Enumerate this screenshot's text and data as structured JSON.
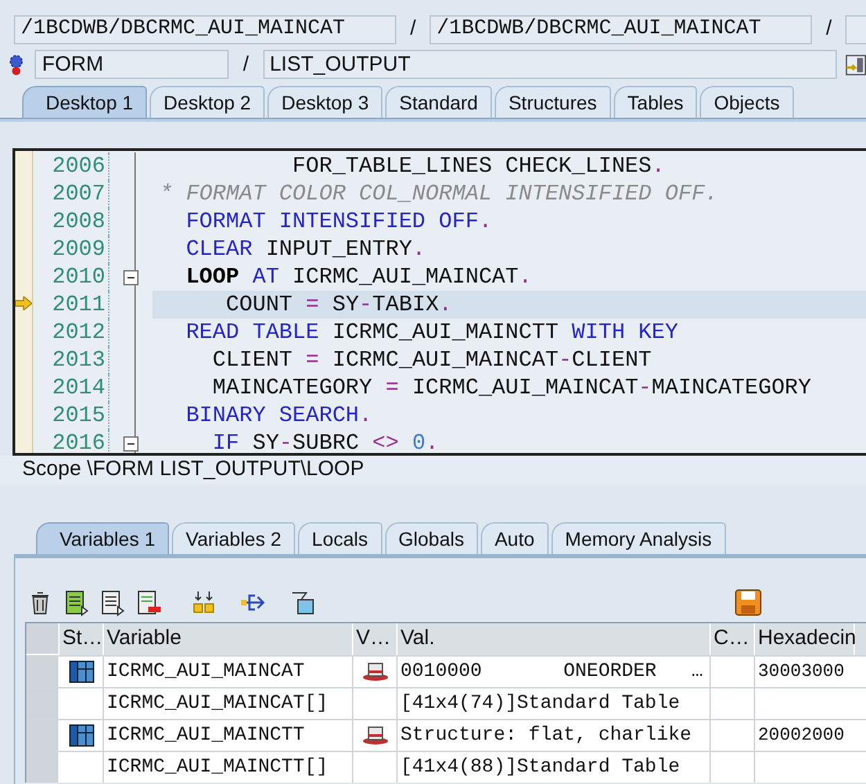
{
  "header": {
    "program_fields": [
      "/1BCDWB/DBCRMC_AUI_MAINCAT",
      "/1BCDWB/DBCRMC_AUI_MAINCAT"
    ],
    "separator": "/",
    "event_type": "FORM",
    "event_name": "LIST_OUTPUT"
  },
  "desktop_tabs": [
    {
      "label": "Desktop 1",
      "selected": true
    },
    {
      "label": "Desktop 2",
      "selected": false
    },
    {
      "label": "Desktop 3",
      "selected": false
    },
    {
      "label": "Standard",
      "selected": false
    },
    {
      "label": "Structures",
      "selected": false
    },
    {
      "label": "Tables",
      "selected": false
    },
    {
      "label": "Objects",
      "selected": false
    }
  ],
  "code": {
    "lines": [
      {
        "number": "2006",
        "current": false,
        "foldable": false,
        "tokens": [
          {
            "kind": "plain",
            "text": "          FOR_TABLE_LINES CHECK_LINES"
          },
          {
            "kind": "operator",
            "text": "."
          }
        ]
      },
      {
        "number": "2007",
        "current": false,
        "foldable": false,
        "tokens": [
          {
            "kind": "comment",
            "text": "* FORMAT COLOR COL_NORMAL INTENSIFIED OFF."
          }
        ]
      },
      {
        "number": "2008",
        "current": false,
        "foldable": false,
        "tokens": [
          {
            "kind": "keyword",
            "text": "  FORMAT INTENSIFIED OFF"
          },
          {
            "kind": "operator",
            "text": "."
          }
        ]
      },
      {
        "number": "2009",
        "current": false,
        "foldable": false,
        "tokens": [
          {
            "kind": "keyword",
            "text": "  CLEAR"
          },
          {
            "kind": "plain",
            "text": " INPUT_ENTRY"
          },
          {
            "kind": "operator",
            "text": "."
          }
        ]
      },
      {
        "number": "2010",
        "current": false,
        "foldable": true,
        "tokens": [
          {
            "kind": "strong",
            "text": "  LOOP"
          },
          {
            "kind": "keyword",
            "text": " AT"
          },
          {
            "kind": "plain",
            "text": " ICRMC_AUI_MAINCAT"
          },
          {
            "kind": "operator",
            "text": "."
          }
        ]
      },
      {
        "number": "2011",
        "current": true,
        "foldable": false,
        "tokens": [
          {
            "kind": "plain",
            "text": "     COUNT "
          },
          {
            "kind": "operator",
            "text": "="
          },
          {
            "kind": "plain",
            "text": " SY"
          },
          {
            "kind": "operator",
            "text": "-"
          },
          {
            "kind": "plain",
            "text": "TABIX"
          },
          {
            "kind": "operator",
            "text": "."
          }
        ]
      },
      {
        "number": "2012",
        "current": false,
        "foldable": false,
        "tokens": [
          {
            "kind": "keyword",
            "text": "  READ TABLE"
          },
          {
            "kind": "plain",
            "text": " ICRMC_AUI_MAINCTT "
          },
          {
            "kind": "keyword",
            "text": "WITH KEY"
          }
        ]
      },
      {
        "number": "2013",
        "current": false,
        "foldable": false,
        "tokens": [
          {
            "kind": "plain",
            "text": "    CLIENT "
          },
          {
            "kind": "operator",
            "text": "="
          },
          {
            "kind": "plain",
            "text": " ICRMC_AUI_MAINCAT"
          },
          {
            "kind": "operator",
            "text": "-"
          },
          {
            "kind": "plain",
            "text": "CLIENT"
          }
        ]
      },
      {
        "number": "2014",
        "current": false,
        "foldable": false,
        "tokens": [
          {
            "kind": "plain",
            "text": "    MAINCATEGORY "
          },
          {
            "kind": "operator",
            "text": "="
          },
          {
            "kind": "plain",
            "text": " ICRMC_AUI_MAINCAT"
          },
          {
            "kind": "operator",
            "text": "-"
          },
          {
            "kind": "plain",
            "text": "MAINCATEGORY"
          }
        ]
      },
      {
        "number": "2015",
        "current": false,
        "foldable": false,
        "tokens": [
          {
            "kind": "keyword",
            "text": "  BINARY SEARCH"
          },
          {
            "kind": "operator",
            "text": "."
          }
        ]
      },
      {
        "number": "2016",
        "current": false,
        "foldable": true,
        "tokens": [
          {
            "kind": "keyword",
            "text": "    IF"
          },
          {
            "kind": "plain",
            "text": " SY"
          },
          {
            "kind": "operator",
            "text": "-"
          },
          {
            "kind": "plain",
            "text": "SUBRC "
          },
          {
            "kind": "operator",
            "text": "<>"
          },
          {
            "kind": "number",
            "text": " 0"
          },
          {
            "kind": "operator",
            "text": "."
          }
        ]
      }
    ]
  },
  "scope": "Scope \\FORM LIST_OUTPUT\\LOOP",
  "variable_tabs": [
    {
      "label": "Variables 1",
      "selected": true
    },
    {
      "label": "Variables 2",
      "selected": false
    },
    {
      "label": "Locals",
      "selected": false
    },
    {
      "label": "Globals",
      "selected": false
    },
    {
      "label": "Auto",
      "selected": false
    },
    {
      "label": "Memory Analysis",
      "selected": false
    }
  ],
  "table": {
    "columns": [
      "St…",
      "Variable",
      "V…",
      "Val.",
      "C…",
      "Hexadecin"
    ],
    "rows": [
      {
        "kind": "structure",
        "variable": "ICRMC_AUI_MAINCAT",
        "value": "0010000       ONEORDER   …",
        "hex": "30003000"
      },
      {
        "kind": "table_body",
        "variable": "ICRMC_AUI_MAINCAT[]",
        "value": "[41x4(74)]Standard Table"
      },
      {
        "kind": "structure",
        "variable": "ICRMC_AUI_MAINCTT",
        "value": "Structure: flat, charlike",
        "hex": "20002000"
      },
      {
        "kind": "table_body",
        "variable": "ICRMC_AUI_MAINCTT[]",
        "value": "[41x4(88)]Standard Table"
      }
    ]
  }
}
